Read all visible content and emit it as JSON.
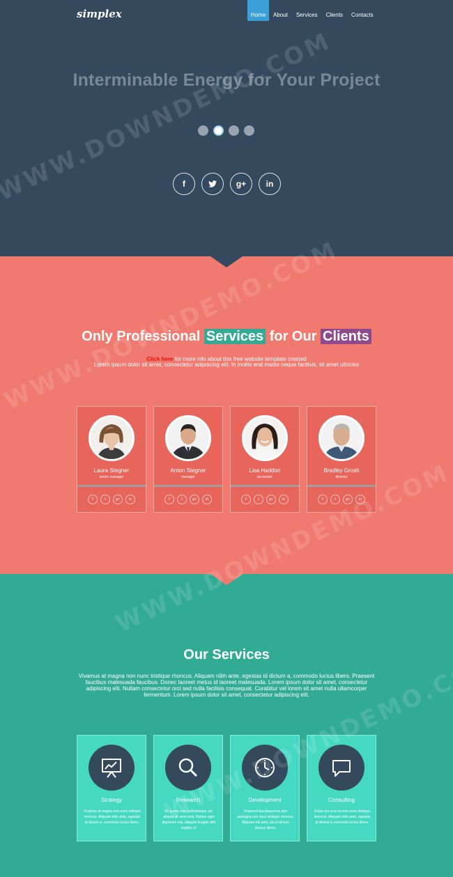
{
  "brand": {
    "logo": "simplex"
  },
  "nav": {
    "items": [
      {
        "label": "Home",
        "active": true
      },
      {
        "label": "About",
        "active": false
      },
      {
        "label": "Services",
        "active": false
      },
      {
        "label": "Clients",
        "active": false
      },
      {
        "label": "Contacts",
        "active": false
      }
    ]
  },
  "hero": {
    "title": "Interminable Energy for Your Project",
    "slider_dots": 4,
    "active_dot": 2,
    "socials": [
      {
        "icon": "facebook-icon",
        "glyph": "f"
      },
      {
        "icon": "twitter-icon",
        "glyph": ""
      },
      {
        "icon": "google-plus-icon",
        "glyph": "g+"
      },
      {
        "icon": "linkedin-icon",
        "glyph": "in"
      }
    ]
  },
  "team": {
    "title_pre": "Only Professional ",
    "title_hl1": "Services",
    "title_mid": " for Our ",
    "title_hl2": "Clients",
    "link_text": "Click here",
    "link_after": " for more info about this free website template created",
    "lorem": "Lorem ipsum dolor sit amet, consectetur adipiscing elit. In mollis erat mattis neque facilisis, sit amet ultricies",
    "members": [
      {
        "name": "Laura Stegner",
        "role": "senior manager"
      },
      {
        "name": "Anton Stegner",
        "role": "manager"
      },
      {
        "name": "Lisa Haddon",
        "role": "accounter"
      },
      {
        "name": "Bradley Grosh",
        "role": "director"
      }
    ],
    "mini_socials": [
      "f",
      "t",
      "g+",
      "in"
    ]
  },
  "services": {
    "title": "Our Services",
    "text": "Vivamus at magna non nunc tristique rhoncus. Aliquam nibh ante, egestas id dictum a, commodo luctus libero. Praesent faucibus malesuada faucibus. Donec laoreet metus id laoreet malesuada. Lorem ipsum dolor sit amet, consectetur adipiscing elit. Nullam consectetur orci sed nulla facilisis consequat. Curabitur vel lorem sit amet nulla ullamcorper fermentum. Lorem ipsum dolor sit amet, consectetur adipiscing elit.",
    "items": [
      {
        "name": "Strategy",
        "icon": "presentation-chart-icon",
        "desc": "Vivamus at magna non nunc tristique rhoncus. Aliquam nibh ante, egestas id dictum a, commodo luctus libero."
      },
      {
        "name": "Research",
        "icon": "magnifier-icon",
        "desc": "Ite auctor non pellentesque vel, aliquet sit amet erat. Nullam eget dignissim nisi, aliquam feugiat nibh sagittis ut."
      },
      {
        "name": "Development",
        "icon": "clock-icon",
        "desc": "Praesent faucibusamus ater asmagna non nunc tristique rhoncus. Aliquam nib ante, las id dictum aluctus libero."
      },
      {
        "name": "Consulting",
        "icon": "chat-bubble-icon",
        "desc": "Etiam dui eros na non nunc tristique rhoncus. Aliquam nibh ante, egestas id dictum a commodo luctus libero."
      }
    ]
  },
  "watermark": "WWW.DOWNDEMO.COM",
  "colors": {
    "navy": "#34495e",
    "coral": "#f07a70",
    "teal": "#32ab95",
    "nav_active": "#3a9fd6",
    "card_coral": "#e8655b",
    "card_teal": "#45d9c4",
    "highlight_green": "#34aa95",
    "highlight_purple": "#8e4a8c"
  }
}
